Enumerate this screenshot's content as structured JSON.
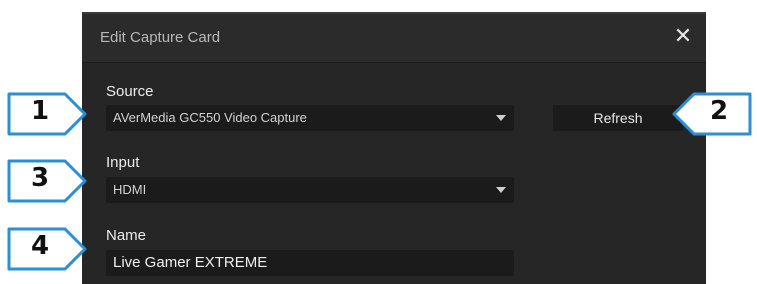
{
  "dialog": {
    "title": "Edit Capture Card",
    "close_glyph": "✕"
  },
  "source": {
    "label": "Source",
    "value": "AVerMedia GC550 Video Capture",
    "refresh_label": "Refresh"
  },
  "input": {
    "label": "Input",
    "value": "HDMI"
  },
  "name": {
    "label": "Name",
    "value": "Live Gamer EXTREME"
  },
  "callouts": [
    "1",
    "2",
    "3",
    "4"
  ],
  "colors": {
    "callout_border": "#2b8fd6",
    "dialog_bg": "#262626",
    "field_bg": "#1b1b1b"
  }
}
